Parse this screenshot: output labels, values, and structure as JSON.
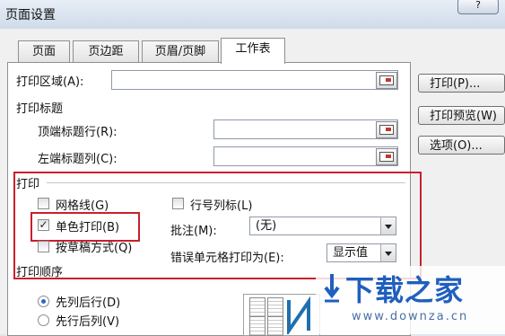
{
  "window": {
    "title": "页面设置",
    "help_label": "?"
  },
  "tabs": [
    {
      "label": "页面"
    },
    {
      "label": "页边距"
    },
    {
      "label": "页眉/页脚"
    },
    {
      "label": "工作表"
    }
  ],
  "print_area": {
    "label": "打印区域(A):",
    "value": ""
  },
  "print_titles": {
    "heading": "打印标题",
    "top_row_label": "顶端标题行(R):",
    "top_row_value": "",
    "left_col_label": "左端标题列(C):",
    "left_col_value": ""
  },
  "print_section": {
    "heading": "打印",
    "gridlines": {
      "label": "网格线(G)",
      "checked": false
    },
    "black_white": {
      "label": "单色打印(B)",
      "checked": true,
      "check_mark": "✓"
    },
    "draft": {
      "label": "按草稿方式(Q)",
      "checked": false
    },
    "row_col_headings": {
      "label": "行号列标(L)",
      "checked": false
    },
    "comments": {
      "label": "批注(M):",
      "value": "(无)"
    },
    "cell_errors": {
      "label": "错误单元格打印为(E):",
      "value": "显示值"
    }
  },
  "page_order": {
    "heading": "打印顺序",
    "down_then_over": {
      "label": "先列后行(D)",
      "selected": true
    },
    "over_then_down": {
      "label": "先行后列(V)",
      "selected": false
    }
  },
  "side_buttons": {
    "print": "打印(P)...",
    "print_preview": "打印预览(W)",
    "options": "选项(O)..."
  },
  "watermark": {
    "logo": "下载之家",
    "url": "www.downza.cn"
  },
  "colors": {
    "highlight_red": "#c8202c",
    "logo_blue": "#1f5fbf"
  }
}
